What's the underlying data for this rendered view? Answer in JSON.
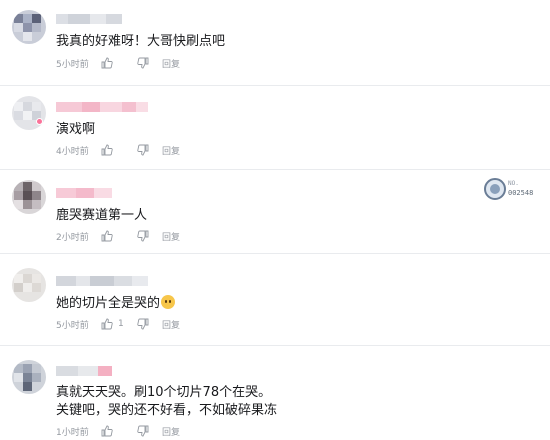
{
  "accent": "#fb7299",
  "meta_color": "#9499a0",
  "labels": {
    "reply": "回复"
  },
  "comments": [
    {
      "text_lines": [
        "我真的好难呀！大哥快刷点吧"
      ],
      "time": "5小时前",
      "likes": ""
    },
    {
      "text_lines": [
        "演戏啊"
      ],
      "time": "4小时前",
      "likes": ""
    },
    {
      "text_lines": [
        "鹿哭赛道第一人"
      ],
      "time": "2小时前",
      "likes": "",
      "badge": {
        "line1": "NO.",
        "line2": "002548",
        "icon": "fan-medal-icon"
      }
    },
    {
      "text_lines": [
        "她的切片全是哭的"
      ],
      "emoji": "laugh-cry-emoji",
      "time": "5小时前",
      "likes": "1"
    },
    {
      "text_lines": [
        "真就天天哭。刷10个切片78个在哭。",
        "关键吧，哭的还不好看，不如破碎果冻"
      ],
      "time": "1小时前",
      "likes": ""
    }
  ],
  "icons": {
    "like": "thumbs-up-icon",
    "dislike": "thumbs-down-icon"
  }
}
